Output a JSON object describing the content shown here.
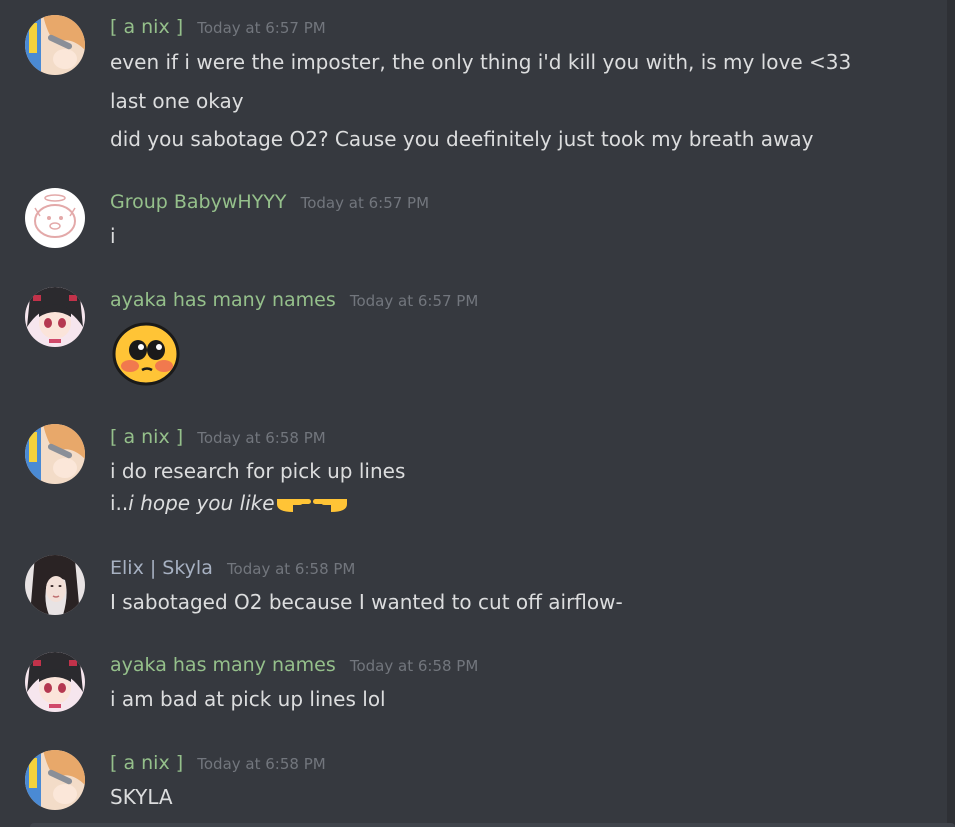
{
  "messages": [
    {
      "author": "[ a nix ]",
      "author_color": "#95c08b",
      "timestamp": "Today at 6:57 PM",
      "lines": [
        "even if i were the imposter, the only thing i'd kill you with, is my love <33",
        "last one okay",
        "did you sabotage O2? Cause you deefinitely just took my breath away"
      ]
    },
    {
      "author": "Group BabywHYYY",
      "author_color": "#95c08b",
      "timestamp": "Today at 6:57 PM",
      "lines": [
        "i"
      ]
    },
    {
      "author": "ayaka has many names",
      "author_color": "#95c08b",
      "timestamp": "Today at 6:57 PM",
      "emoji": "pleading-blushing-face-emoji"
    },
    {
      "author": "[ a nix ]",
      "author_color": "#95c08b",
      "timestamp": "Today at 6:58 PM",
      "lines": [
        "i do research for pick up lines"
      ],
      "line2_prefix": "i..",
      "line2_italic": "i hope you like",
      "line2_emojis": [
        "pointing-right-emoji",
        "pointing-left-emoji"
      ]
    },
    {
      "author": "Elix | Skyla",
      "author_color": "#a7b1c2",
      "timestamp": "Today at 6:58 PM",
      "lines": [
        "I sabotaged O2 because I wanted to cut off airflow-"
      ]
    },
    {
      "author": "ayaka has many names",
      "author_color": "#95c08b",
      "timestamp": "Today at 6:58 PM",
      "lines": [
        "i am bad at pick up lines lol"
      ]
    },
    {
      "author": "[ a nix ]",
      "author_color": "#95c08b",
      "timestamp": "Today at 6:58 PM",
      "lines": [
        "SKYLA"
      ]
    }
  ]
}
